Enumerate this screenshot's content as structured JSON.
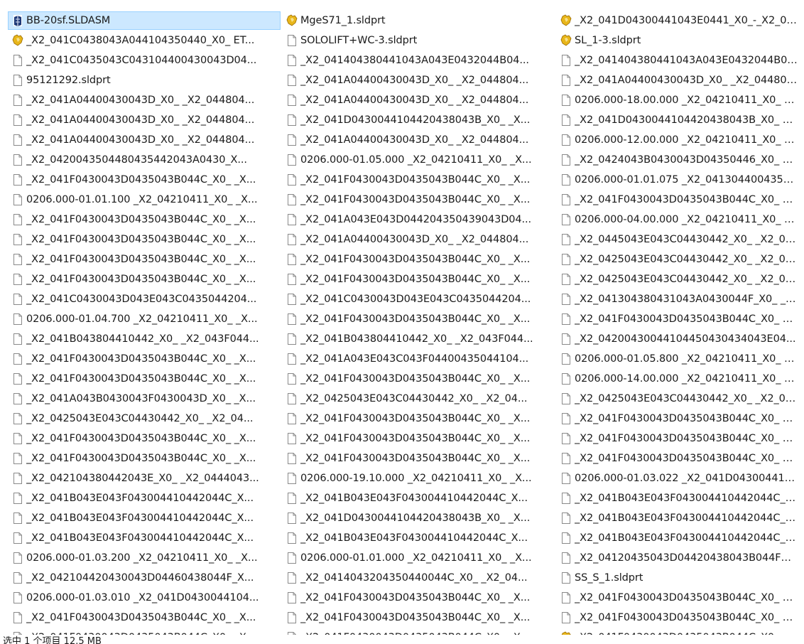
{
  "icons": {
    "doc": "blank-file-icon",
    "part": "solidworks-part-icon",
    "asm": "solidworks-assembly-icon"
  },
  "colors": {
    "selection_bg": "#cce8ff",
    "selection_border": "#99d1ff",
    "part_icon": "#e8b61a",
    "asm_icon": "#1f3a78"
  },
  "columns": [
    [
      {
        "name": "BB-20sf.SLDASM",
        "icon": "asm",
        "selected": true
      },
      {
        "name": "_X2_041C0438043A044104350440_X0_ ET...",
        "icon": "part"
      },
      {
        "name": "_X2_041C0435043C043104400430043D04...",
        "icon": "doc"
      },
      {
        "name": "95121292.sldprt",
        "icon": "doc"
      },
      {
        "name": "_X2_041A04400430043D_X0_ _X2_044804...",
        "icon": "doc"
      },
      {
        "name": "_X2_041A04400430043D_X0_ _X2_044804...",
        "icon": "doc"
      },
      {
        "name": "_X2_041A04400430043D_X0_ _X2_044804...",
        "icon": "doc"
      },
      {
        "name": "_X2_0420043504480435442043A0430_X...",
        "icon": "doc"
      },
      {
        "name": "_X2_041F0430043D0435043B044C_X0_ _X...",
        "icon": "doc"
      },
      {
        "name": "0206.000-01.01.100 _X2_04210411_X0_ _X...",
        "icon": "doc"
      },
      {
        "name": "_X2_041F0430043D0435043B044C_X0_ _X...",
        "icon": "doc"
      },
      {
        "name": "_X2_041F0430043D0435043B044C_X0_ _X...",
        "icon": "doc"
      },
      {
        "name": "_X2_041F0430043D0435043B044C_X0_ _X...",
        "icon": "doc"
      },
      {
        "name": "_X2_041F0430043D0435043B044C_X0_ _X...",
        "icon": "doc"
      },
      {
        "name": "_X2_041C0430043D043E043C0435044204...",
        "icon": "doc"
      },
      {
        "name": "0206.000-01.04.700 _X2_04210411_X0_ _X...",
        "icon": "doc"
      },
      {
        "name": "_X2_041B043804410442_X0_ _X2_043F044...",
        "icon": "doc"
      },
      {
        "name": "_X2_041F0430043D0435043B044C_X0_ _X...",
        "icon": "doc"
      },
      {
        "name": "_X2_041F0430043D0435043B044C_X0_ _X...",
        "icon": "doc"
      },
      {
        "name": "_X2_041A043B0430043F0430043D_X0_ _X...",
        "icon": "doc"
      },
      {
        "name": "_X2_0425043E043C04430442_X0_ _X2_04...",
        "icon": "doc"
      },
      {
        "name": "_X2_041F0430043D0435043B044C_X0_ _X...",
        "icon": "doc"
      },
      {
        "name": "_X2_041F0430043D0435043B044C_X0_ _X...",
        "icon": "doc"
      },
      {
        "name": "_X2_042104380442043E_X0_ _X2_0444043...",
        "icon": "doc"
      },
      {
        "name": "_X2_041B043E043F043004410442044C_X...",
        "icon": "doc"
      },
      {
        "name": "_X2_041B043E043F043004410442044C_X...",
        "icon": "doc"
      },
      {
        "name": "_X2_041B043E043F043004410442044C_X...",
        "icon": "doc"
      },
      {
        "name": "0206.000-01.03.200 _X2_04210411_X0_ _X...",
        "icon": "doc"
      },
      {
        "name": "_X2_042104420430043D04460438044F_X...",
        "icon": "doc"
      },
      {
        "name": "0206.000-01.03.010 _X2_041D0430044104...",
        "icon": "doc"
      },
      {
        "name": "_X2_041F0430043D0435043B044C_X0_ _X...",
        "icon": "doc"
      },
      {
        "name": "_X2_041F0430043D0435043B044C_X0_ _X...",
        "icon": "doc"
      }
    ],
    [
      {
        "name": "MgeS71_1.sldprt",
        "icon": "part"
      },
      {
        "name": "SOLOLIFT+WC-3.sldprt",
        "icon": "doc"
      },
      {
        "name": "_X2_041404380441043A043E0432044B04...",
        "icon": "doc"
      },
      {
        "name": "_X2_041A04400430043D_X0_ _X2_044804...",
        "icon": "doc"
      },
      {
        "name": "_X2_041A04400430043D_X0_ _X2_044804...",
        "icon": "doc"
      },
      {
        "name": "_X2_041D0430044104420438043B_X0_ _X...",
        "icon": "doc"
      },
      {
        "name": "_X2_041A04400430043D_X0_ _X2_044804...",
        "icon": "doc"
      },
      {
        "name": "0206.000-01.05.000 _X2_04210411_X0_ _X...",
        "icon": "doc"
      },
      {
        "name": "_X2_041F0430043D0435043B044C_X0_ _X...",
        "icon": "doc"
      },
      {
        "name": "_X2_041F0430043D0435043B044C_X0_ _X...",
        "icon": "doc"
      },
      {
        "name": "_X2_041A043E043D044204350439043D04...",
        "icon": "doc"
      },
      {
        "name": "_X2_041A04400430043D_X0_ _X2_044804...",
        "icon": "doc"
      },
      {
        "name": "_X2_041F0430043D0435043B044C_X0_ _X...",
        "icon": "doc"
      },
      {
        "name": "_X2_041F0430043D0435043B044C_X0_ _X...",
        "icon": "doc"
      },
      {
        "name": "_X2_041C0430043D043E043C0435044204...",
        "icon": "doc"
      },
      {
        "name": "_X2_041F0430043D0435043B044C_X0_ _X...",
        "icon": "doc"
      },
      {
        "name": "_X2_041B043804410442_X0_ _X2_043F044...",
        "icon": "doc"
      },
      {
        "name": "_X2_041A043E043C043F04400435044104...",
        "icon": "doc"
      },
      {
        "name": "_X2_041F0430043D0435043B044C_X0_ _X...",
        "icon": "doc"
      },
      {
        "name": "_X2_0425043E043C04430442_X0_ _X2_04...",
        "icon": "doc"
      },
      {
        "name": "_X2_041F0430043D0435043B044C_X0_ _X...",
        "icon": "doc"
      },
      {
        "name": "_X2_041F0430043D0435043B044C_X0_ _X...",
        "icon": "doc"
      },
      {
        "name": "_X2_041F0430043D0435043B044C_X0_ _X...",
        "icon": "doc"
      },
      {
        "name": "0206.000-19.10.000 _X2_04210411_X0_ _X...",
        "icon": "doc"
      },
      {
        "name": "_X2_041B043E043F043004410442044C_X...",
        "icon": "doc"
      },
      {
        "name": "_X2_041D0430044104420438043B_X0_ _X...",
        "icon": "doc"
      },
      {
        "name": "_X2_041B043E043F043004410442044C_X...",
        "icon": "doc"
      },
      {
        "name": "0206.000-01.01.000 _X2_04210411_X0_ _X...",
        "icon": "doc"
      },
      {
        "name": "_X2_0414043204350440044C_X0_ _X2_04...",
        "icon": "doc"
      },
      {
        "name": "_X2_041F0430043D0435043B044C_X0_ _X...",
        "icon": "doc"
      },
      {
        "name": "_X2_041F0430043D0435043B044C_X0_ _X...",
        "icon": "doc"
      },
      {
        "name": "_X2_041F0430043D0435043B044C_X0_ _X...",
        "icon": "doc"
      }
    ],
    [
      {
        "name": "_X2_041D04300441043E0441_X0_-_X2_04...",
        "icon": "part"
      },
      {
        "name": "SL_1-3.sldprt",
        "icon": "part"
      },
      {
        "name": "_X2_041404380441043A043E0432044B04...",
        "icon": "doc"
      },
      {
        "name": "_X2_041A04400430043D_X0_ _X2_044804...",
        "icon": "doc"
      },
      {
        "name": "0206.000-18.00.000 _X2_04210411_X0_ _X...",
        "icon": "doc"
      },
      {
        "name": "_X2_041D0430044104420438043B_X0_ _X...",
        "icon": "doc"
      },
      {
        "name": "0206.000-12.00.000 _X2_04210411_X0_ _X...",
        "icon": "doc"
      },
      {
        "name": "_X2_0424043B0430043D04350446_X0_ _X...",
        "icon": "doc"
      },
      {
        "name": "0206.000-01.01.075 _X2_04130440043504...",
        "icon": "doc"
      },
      {
        "name": "_X2_041F0430043D0435043B044C_X0_ _X...",
        "icon": "doc"
      },
      {
        "name": "0206.000-04.00.000 _X2_04210411_X0_ _X...",
        "icon": "doc"
      },
      {
        "name": "_X2_0445043E043C04430442_X0_ _X2_04...",
        "icon": "doc"
      },
      {
        "name": "_X2_0425043E043C04430442_X0_ _X2_04...",
        "icon": "doc"
      },
      {
        "name": "_X2_0425043E043C04430442_X0_ _X2_04...",
        "icon": "doc"
      },
      {
        "name": "_X2_041304380431043A0430044F_X0_ _X...",
        "icon": "doc"
      },
      {
        "name": "_X2_041F0430043D0435043B044C_X0_ _X...",
        "icon": "doc"
      },
      {
        "name": "_X2_04200430044104450430434043E04...",
        "icon": "doc"
      },
      {
        "name": "0206.000-01.05.800 _X2_04210411_X0_ _X...",
        "icon": "doc"
      },
      {
        "name": "0206.000-14.00.000 _X2_04210411_X0_ _X...",
        "icon": "doc"
      },
      {
        "name": "_X2_0425043E043C04430442_X0_ _X2_04...",
        "icon": "doc"
      },
      {
        "name": "_X2_041F0430043D0435043B044C_X0_ _X...",
        "icon": "doc"
      },
      {
        "name": "_X2_041F0430043D0435043B044C_X0_ _X...",
        "icon": "doc"
      },
      {
        "name": "_X2_041F0430043D0435043B044C_X0_ _X...",
        "icon": "doc"
      },
      {
        "name": "0206.000-01.03.022 _X2_041D0430044104...",
        "icon": "doc"
      },
      {
        "name": "_X2_041B043E043F043004410442044C_X...",
        "icon": "doc"
      },
      {
        "name": "_X2_041B043E043F043004410442044C_X...",
        "icon": "doc"
      },
      {
        "name": "_X2_041B043E043F043004410442044C_X...",
        "icon": "doc"
      },
      {
        "name": "_X2_04120435043D04420438043B044F04...",
        "icon": "doc"
      },
      {
        "name": "SS_S_1.sldprt",
        "icon": "doc"
      },
      {
        "name": "_X2_041F0430043D0435043B044C_X0_ _X...",
        "icon": "doc"
      },
      {
        "name": "_X2_041F0430043D0435043B044C_X0_ _X...",
        "icon": "doc"
      },
      {
        "name": "_X2_041F0430043D0435043B044C_X0_ _X...",
        "icon": "part"
      }
    ]
  ],
  "statusbar": {
    "text": "选中 1 个项目  12.5 MB"
  }
}
